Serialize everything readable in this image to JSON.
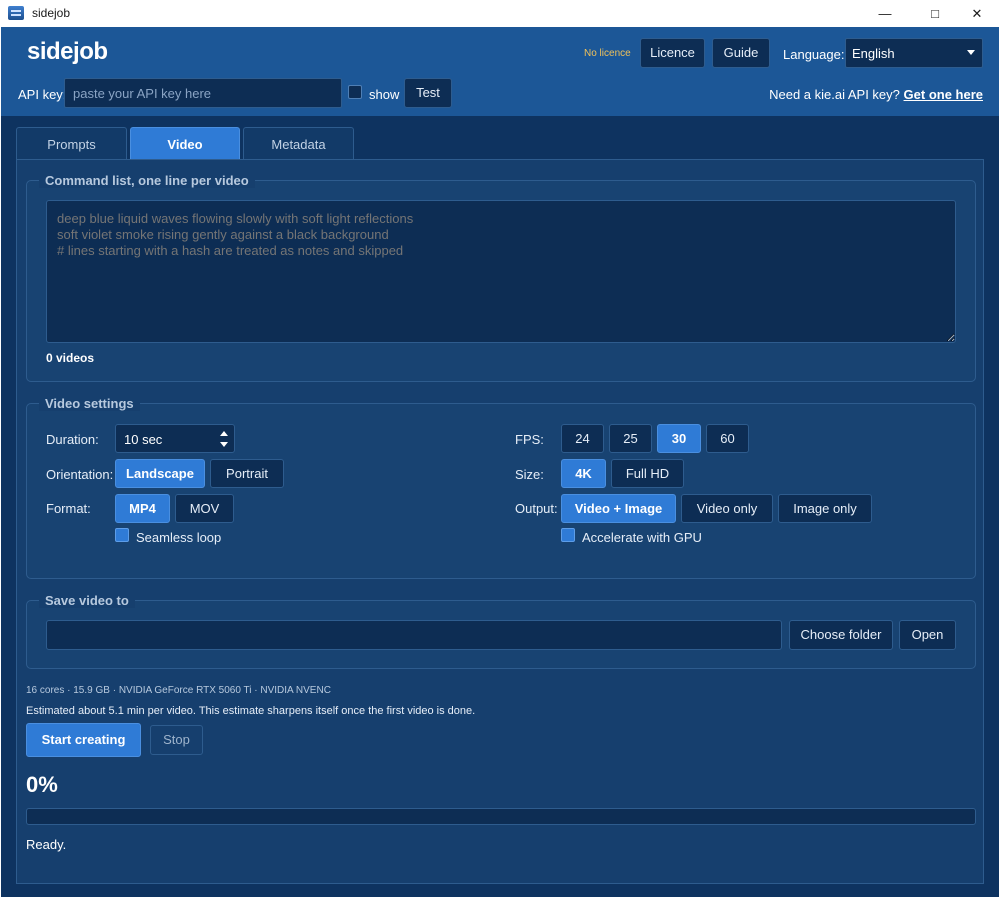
{
  "window": {
    "title": "sidejob",
    "controls": [
      "minimize",
      "maximize",
      "close"
    ]
  },
  "header": {
    "brand": "sidejob",
    "licence_status": "No licence",
    "licence_button": "Licence",
    "guide_button": "Guide",
    "language_label": "Language:",
    "language_value": "English",
    "api_label": "API key:",
    "api_placeholder": "paste your API key here",
    "show_label": "show",
    "show_checked": false,
    "test_button": "Test",
    "need_key_text": "Need a kie.ai API key?",
    "get_one_link": "Get one here"
  },
  "tabs": [
    {
      "label": "Prompts",
      "active": false
    },
    {
      "label": "Video",
      "active": true
    },
    {
      "label": "Metadata",
      "active": false
    }
  ],
  "commands": {
    "title": "Command list, one line per video",
    "placeholder": "deep blue liquid waves flowing slowly with soft light reflections\nsoft violet smoke rising gently against a black background\n# lines starting with a hash are treated as notes and skipped",
    "count_label": "0 videos"
  },
  "settings": {
    "title": "Video settings",
    "duration_label": "Duration:",
    "duration_value": "10 sec",
    "orientation_label": "Orientation:",
    "orientation_options": [
      "Landscape",
      "Portrait"
    ],
    "orientation_selected": "Landscape",
    "format_label": "Format:",
    "format_options": [
      "MP4",
      "MOV"
    ],
    "format_selected": "MP4",
    "seamless_label": "Seamless loop",
    "seamless_checked": true,
    "fps_label": "FPS:",
    "fps_options": [
      "24",
      "25",
      "30",
      "60"
    ],
    "fps_selected": "30",
    "size_label": "Size:",
    "size_options": [
      "4K",
      "Full HD"
    ],
    "size_selected": "4K",
    "output_label": "Output:",
    "output_options": [
      "Video + Image",
      "Video only",
      "Image only"
    ],
    "output_selected": "Video + Image",
    "gpu_label": "Accelerate with GPU",
    "gpu_checked": true
  },
  "save": {
    "title": "Save video to",
    "path": "",
    "choose_button": "Choose folder",
    "open_button": "Open"
  },
  "footer": {
    "sysinfo": "16 cores  ·  15.9 GB  ·  NVIDIA GeForce RTX 5060 Ti  ·  NVIDIA NVENC",
    "estimate": "Estimated about 5.1 min per video. This estimate sharpens itself once the first video is done.",
    "start_button": "Start creating",
    "stop_button": "Stop",
    "progress_percent": "0%",
    "progress_fraction": 0,
    "status": "Ready."
  },
  "colors": {
    "header_bg": "#1c5797",
    "panel_bg": "#163f6e",
    "accent": "#2f7bd6",
    "field_bg": "#0d2d54",
    "licence_warning": "#f0c15a"
  }
}
